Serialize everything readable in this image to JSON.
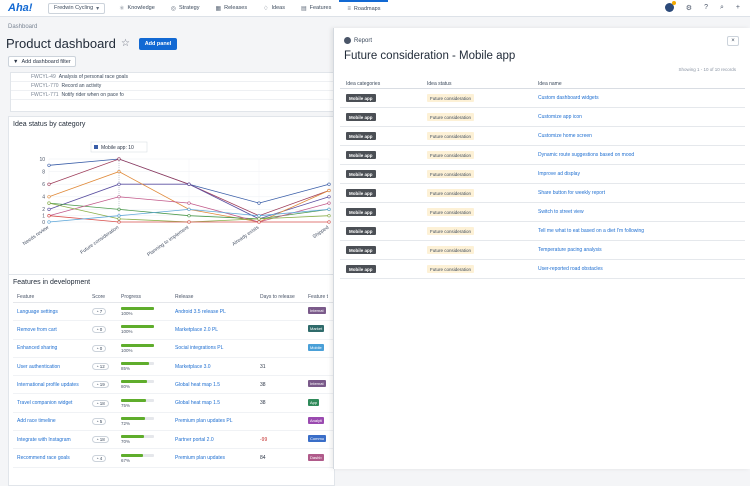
{
  "nav": {
    "logo": "Aha!",
    "workspace": "Fredwin Cycling",
    "items": [
      "Knowledge",
      "Strategy",
      "Releases",
      "Ideas",
      "Features",
      "Roadmaps"
    ]
  },
  "page": {
    "breadcrumb": "Dashboard",
    "title": "Product dashboard",
    "add_panel": "Add panel",
    "add_filter": "Add dashboard filter"
  },
  "mini_list": [
    {
      "id": "FWCYL-49",
      "text": "Analysis of personal race goals"
    },
    {
      "id": "FWCYL-770",
      "text": "Record an activity"
    },
    {
      "id": "FWCYL-771",
      "text": "Notify rider when on pace fo"
    }
  ],
  "chart_panel": {
    "title": "Idea status by category",
    "tooltip_label": "Mobile app:",
    "tooltip_value": "10"
  },
  "chart_data": {
    "type": "line",
    "title": "Idea status by category",
    "categories": [
      "Needs review",
      "Future consideration",
      "Planning to implement",
      "Already exists",
      "Shipped"
    ],
    "ylim": [
      0,
      10
    ],
    "yticks": [
      0,
      1,
      2,
      4,
      6,
      8,
      10
    ],
    "series": [
      {
        "name": "Mobile app",
        "color": "#3a5ea8",
        "values": [
          9,
          10,
          6,
          3,
          6
        ]
      },
      {
        "name": "",
        "color": "#9e3d5a",
        "values": [
          6,
          10,
          6,
          1,
          5
        ]
      },
      {
        "name": "",
        "color": "#5a4fa0",
        "values": [
          2,
          6,
          6,
          0.5,
          4
        ]
      },
      {
        "name": "",
        "color": "#e08a3a",
        "values": [
          4,
          8,
          2,
          0,
          5
        ]
      },
      {
        "name": "",
        "color": "#4d9a4d",
        "values": [
          3,
          2,
          1,
          0.5,
          2
        ]
      },
      {
        "name": "",
        "color": "#c25a8a",
        "values": [
          1,
          4,
          3,
          0,
          3
        ]
      },
      {
        "name": "",
        "color": "#8ab04a",
        "values": [
          3,
          0.5,
          0,
          0.5,
          1
        ]
      },
      {
        "name": "",
        "color": "#d9534f",
        "values": [
          1,
          0,
          0,
          0,
          0
        ]
      },
      {
        "name": "",
        "color": "#5fa7d9",
        "values": [
          0,
          1,
          2,
          1,
          2
        ]
      }
    ]
  },
  "features_panel": {
    "title": "Features in development",
    "headers": [
      "Feature",
      "Score",
      "Progress",
      "Release",
      "Days to release",
      "Feature t"
    ],
    "rows": [
      {
        "name": "Language settings",
        "score": "7",
        "progress": 100,
        "pct": "100%",
        "release": "Android 3.5 release PL",
        "days": "",
        "tag": "Internat",
        "tagcolor": "#7a5a8a"
      },
      {
        "name": "Remove from cart",
        "score": "0",
        "progress": 100,
        "pct": "100%",
        "release": "Marketplace 2.0 PL",
        "days": "",
        "tag": "Market",
        "tagcolor": "#2f6b6b"
      },
      {
        "name": "Enhanced sharing",
        "score": "0",
        "progress": 100,
        "pct": "100%",
        "release": "Social integrations PL",
        "days": "",
        "tag": "Mobile",
        "tagcolor": "#4aa0d8"
      },
      {
        "name": "User authentication",
        "score": "12",
        "progress": 85,
        "pct": "85%",
        "release": "Marketplace 3.0",
        "days": "31",
        "tag": "",
        "tagcolor": ""
      },
      {
        "name": "International profile updates",
        "score": "19",
        "progress": 80,
        "pct": "80%",
        "release": "Global heat map 1.5",
        "days": "38",
        "tag": "Internat",
        "tagcolor": "#7a5a8a"
      },
      {
        "name": "Travel companion widget",
        "score": "18",
        "progress": 75,
        "pct": "75%",
        "release": "Global heat map 1.5",
        "days": "38",
        "tag": "App",
        "tagcolor": "#2f8a5a"
      },
      {
        "name": "Add race timeline",
        "score": "5",
        "progress": 72,
        "pct": "72%",
        "release": "Premium plan updates PL",
        "days": "",
        "tag": "Analyti",
        "tagcolor": "#9a4ab0"
      },
      {
        "name": "Integrate with Instagram",
        "score": "18",
        "progress": 70,
        "pct": "70%",
        "release": "Partner portal 2.0",
        "days": "-99",
        "tag": "Commu",
        "tagcolor": "#3a6ec8"
      },
      {
        "name": "Recommend race goals",
        "score": "4",
        "progress": 67,
        "pct": "67%",
        "release": "Premium plan updates",
        "days": "84",
        "tag": "Dashb",
        "tagcolor": "#b05a8a"
      }
    ]
  },
  "report": {
    "label": "Report",
    "title": "Future consideration - Mobile app",
    "close": "×",
    "showing": "Showing 1 - 10 of 10 records",
    "headers": [
      "Idea categories",
      "Idea status",
      "Idea name"
    ],
    "rows": [
      {
        "category": "Mobile app",
        "status": "Future consideration",
        "name": "Custom dashboard widgets"
      },
      {
        "category": "Mobile app",
        "status": "Future consideration",
        "name": "Customize app icon"
      },
      {
        "category": "Mobile app",
        "status": "Future consideration",
        "name": "Customize home screen"
      },
      {
        "category": "Mobile app",
        "status": "Future consideration",
        "name": "Dynamic route suggestions based on mood"
      },
      {
        "category": "Mobile app",
        "status": "Future consideration",
        "name": "Improve ad display"
      },
      {
        "category": "Mobile app",
        "status": "Future consideration",
        "name": "Share button for weekly report"
      },
      {
        "category": "Mobile app",
        "status": "Future consideration",
        "name": "Switch to street view"
      },
      {
        "category": "Mobile app",
        "status": "Future consideration",
        "name": "Tell me what to eat based on a diet I'm following"
      },
      {
        "category": "Mobile app",
        "status": "Future consideration",
        "name": "Temperature pacing analysis"
      },
      {
        "category": "Mobile app",
        "status": "Future consideration",
        "name": "User-reported road obstacles"
      }
    ]
  }
}
